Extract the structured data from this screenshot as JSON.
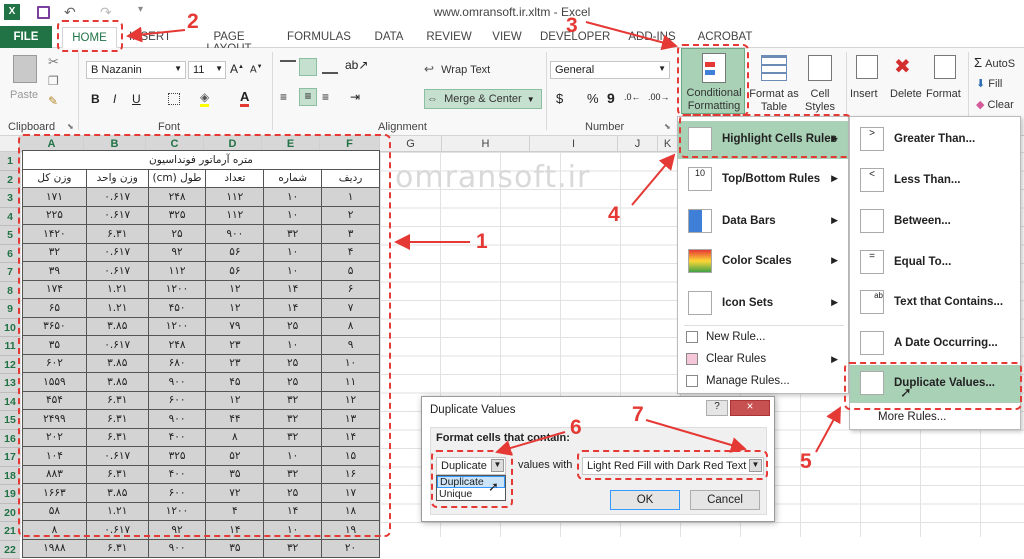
{
  "window": {
    "title": "www.omransoft.ir.xltm - Excel"
  },
  "tabs": [
    "FILE",
    "HOME",
    "INSERT",
    "PAGE LAYOUT",
    "FORMULAS",
    "DATA",
    "REVIEW",
    "VIEW",
    "DEVELOPER",
    "ADD-INS",
    "ACROBAT"
  ],
  "ribbon": {
    "paste": "Paste",
    "font_name": "B Nazanin",
    "font_size": "11",
    "wrap_text": "Wrap Text",
    "merge_center": "Merge & Center",
    "number_format": "General",
    "percent": "%",
    "comma": "9",
    "currency": "$",
    "conditional_formatting": "Conditional Formatting",
    "format_as_table": "Format as Table",
    "cell_styles": "Cell Styles",
    "insert": "Insert",
    "delete": "Delete",
    "format": "Format",
    "autosum": "AutoS",
    "fill": "Fill",
    "clear": "Clear",
    "groups": {
      "clipboard": "Clipboard",
      "font": "Font",
      "alignment": "Alignment",
      "number": "Number"
    }
  },
  "columns": [
    "A",
    "B",
    "C",
    "D",
    "E",
    "F",
    "G",
    "H",
    "I",
    "J",
    "K"
  ],
  "rows": [
    "1",
    "2",
    "3",
    "4",
    "5",
    "6",
    "7",
    "8",
    "9",
    "10",
    "11",
    "12",
    "13",
    "14",
    "15",
    "16",
    "17",
    "18",
    "19",
    "20",
    "21",
    "22"
  ],
  "table": {
    "title": "متره آرماتور فونداسیون",
    "headers": [
      "وزن کل",
      "وزن واحد",
      "طول (cm)",
      "تعداد",
      "شماره",
      "ردیف"
    ],
    "rows": [
      [
        "۱۷۱",
        "۰.۶۱۷",
        "۲۴۸",
        "۱۱۲",
        "۱۰",
        "۱"
      ],
      [
        "۲۲۵",
        "۰.۶۱۷",
        "۳۲۵",
        "۱۱۲",
        "۱۰",
        "۲"
      ],
      [
        "۱۴۲۰",
        "۶.۳۱",
        "۲۵",
        "۹۰۰",
        "۳۲",
        "۳"
      ],
      [
        "۳۲",
        "۰.۶۱۷",
        "۹۲",
        "۵۶",
        "۱۰",
        "۴"
      ],
      [
        "۳۹",
        "۰.۶۱۷",
        "۱۱۲",
        "۵۶",
        "۱۰",
        "۵"
      ],
      [
        "۱۷۴",
        "۱.۲۱",
        "۱۲۰۰",
        "۱۲",
        "۱۴",
        "۶"
      ],
      [
        "۶۵",
        "۱.۲۱",
        "۴۵۰",
        "۱۲",
        "۱۴",
        "۷"
      ],
      [
        "۳۶۵۰",
        "۳.۸۵",
        "۱۲۰۰",
        "۷۹",
        "۲۵",
        "۸"
      ],
      [
        "۳۵",
        "۰.۶۱۷",
        "۲۴۸",
        "۲۳",
        "۱۰",
        "۹"
      ],
      [
        "۶۰۲",
        "۳.۸۵",
        "۶۸۰",
        "۲۳",
        "۲۵",
        "۱۰"
      ],
      [
        "۱۵۵۹",
        "۳.۸۵",
        "۹۰۰",
        "۴۵",
        "۲۵",
        "۱۱"
      ],
      [
        "۴۵۴",
        "۶.۳۱",
        "۶۰۰",
        "۱۲",
        "۳۲",
        "۱۲"
      ],
      [
        "۲۴۹۹",
        "۶.۳۱",
        "۹۰۰",
        "۴۴",
        "۳۲",
        "۱۳"
      ],
      [
        "۲۰۲",
        "۶.۳۱",
        "۴۰۰",
        "۸",
        "۳۲",
        "۱۴"
      ],
      [
        "۱۰۴",
        "۰.۶۱۷",
        "۳۲۵",
        "۵۲",
        "۱۰",
        "۱۵"
      ],
      [
        "۸۸۳",
        "۶.۳۱",
        "۴۰۰",
        "۳۵",
        "۳۲",
        "۱۶"
      ],
      [
        "۱۶۶۳",
        "۳.۸۵",
        "۶۰۰",
        "۷۲",
        "۲۵",
        "۱۷"
      ],
      [
        "۵۸",
        "۱.۲۱",
        "۱۲۰۰",
        "۴",
        "۱۴",
        "۱۸"
      ],
      [
        "۸",
        "۰.۶۱۷",
        "۹۲",
        "۱۴",
        "۱۰",
        "۱۹"
      ],
      [
        "۱۹۸۸",
        "۶.۳۱",
        "۹۰۰",
        "۳۵",
        "۳۲",
        "۲۰"
      ]
    ]
  },
  "watermark": "omransoft.ir",
  "cf_menu": {
    "highlight": "Highlight Cells Rules",
    "topbottom": "Top/Bottom Rules",
    "databars": "Data Bars",
    "colorscales": "Color Scales",
    "iconsets": "Icon Sets",
    "newrule": "New Rule...",
    "clearrules": "Clear Rules",
    "managerules": "Manage Rules..."
  },
  "submenu": {
    "greater": "Greater Than...",
    "less": "Less Than...",
    "between": "Between...",
    "equal": "Equal To...",
    "textcontains": "Text that Contains...",
    "dateoccurring": "A Date Occurring...",
    "duplicate": "Duplicate Values...",
    "morerules": "More Rules..."
  },
  "dialog": {
    "title": "Duplicate Values",
    "help": "?",
    "close": "×",
    "label": "Format cells that contain:",
    "select_value": "Duplicate",
    "options": [
      "Duplicate",
      "Unique"
    ],
    "values_with": "values with",
    "format_value": "Light Red Fill with Dark Red Text",
    "ok": "OK",
    "cancel": "Cancel"
  },
  "callouts": [
    "1",
    "2",
    "3",
    "4",
    "5",
    "6",
    "7"
  ]
}
